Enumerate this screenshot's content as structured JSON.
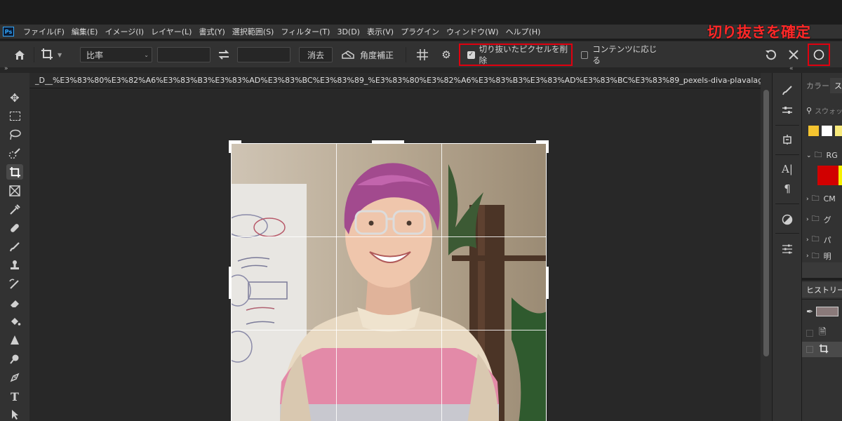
{
  "app": {
    "logo": "Ps",
    "menu": [
      "ファイル(F)",
      "編集(E)",
      "イメージ(I)",
      "レイヤー(L)",
      "書式(Y)",
      "選択範囲(S)",
      "フィルター(T)",
      "3D(D)",
      "表示(V)",
      "プラグイン",
      "ウィンドウ(W)",
      "ヘルプ(H)"
    ]
  },
  "options_bar": {
    "home_icon": "home-icon",
    "crop_tool_icon": "crop-icon",
    "ratio_select": "比率",
    "width_value": "",
    "height_value": "",
    "swap_icon": "swap-arrows-icon",
    "clear_label": "消去",
    "straighten_label": "角度補正",
    "overlay_icon": "grid-overlay-icon",
    "settings_icon": "gear-icon",
    "delete_cropped_label": "切り抜いたピクセルを削除",
    "delete_cropped_checked": true,
    "content_aware_label": "コンテンツに応じる",
    "content_aware_checked": false,
    "reset_icon": "reset-icon",
    "cancel_icon": "close-icon",
    "commit_icon": "commit-circle-icon"
  },
  "annotation": {
    "text": "切り抜きを確定",
    "color": "#ff2828"
  },
  "document": {
    "tab_title": "_D__%E3%83%80%E3%82%A6%E3%83%B3%E3%83%AD%E3%83%BC%E3%83%89_%E3%83%80%E3%82%A6%E3%83%B3%E3%83%AD%E3%83%BC%E3%83%89_pexels-diva-plavalaguna"
  },
  "right_panel": {
    "tabs": [
      "カラー",
      "ス"
    ],
    "search_placeholder": "スウォッ",
    "swatches": [
      "#f4c430",
      "#ffffff",
      "#f7e97a"
    ],
    "groups": [
      {
        "label": "RG"
      },
      {
        "label": "CM"
      },
      {
        "label": "グ"
      },
      {
        "label": "パ"
      },
      {
        "label": "明"
      }
    ],
    "group_swatches": [
      "#d10000",
      "#f5f000"
    ],
    "history_tab": "ヒストリー"
  },
  "colors": {
    "highlight": "#e0000f",
    "panel_bg": "#323232",
    "canvas_bg": "#282828"
  }
}
